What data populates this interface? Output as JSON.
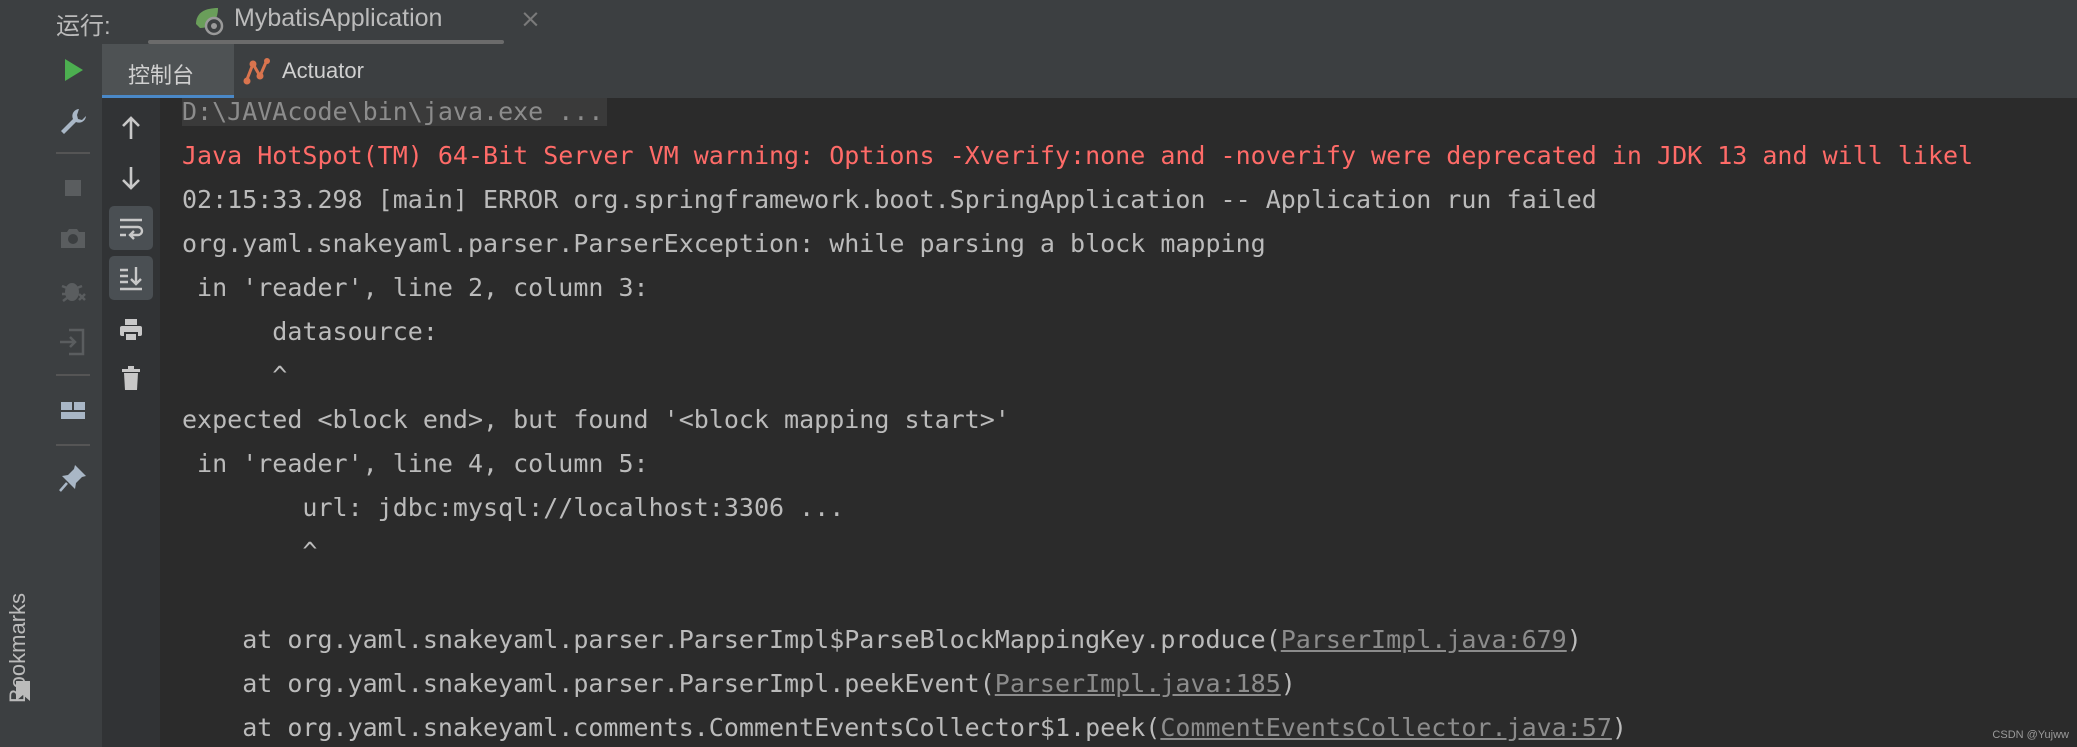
{
  "run_bar": {
    "label": "运行:",
    "config_name": "MybatisApplication",
    "close_glyph": "×"
  },
  "side_panel": {
    "bookmarks_label": "Bookmarks"
  },
  "tabs": [
    {
      "label": "控制台",
      "active": true
    },
    {
      "label": "Actuator",
      "active": false
    }
  ],
  "icons": {
    "left_toolbar": [
      "run-icon",
      "build-wrench-icon",
      "stop-icon",
      "camera-icon",
      "debug-bug-icon",
      "login-icon",
      "layout-icon",
      "pin-icon"
    ],
    "console_toolbar": [
      "scroll-up-icon",
      "scroll-down-icon",
      "soft-wrap-icon",
      "scroll-to-end-icon",
      "print-icon",
      "trash-icon"
    ]
  },
  "colors": {
    "background": "#2b2b2b",
    "error_text": "#ff6b68",
    "normal_text": "#bbbbbb",
    "run_green": "#4caf50"
  },
  "console": {
    "lines": [
      {
        "text": "D:\\JAVAcode\\bin\\java.exe ..."
      },
      {
        "text": "Java HotSpot(TM) 64-Bit Server VM warning: Options -Xverify:none and -noverify were deprecated in JDK 13 and will likel"
      },
      {
        "text": "02:15:33.298 [main] ERROR org.springframework.boot.SpringApplication -- Application run failed"
      },
      {
        "text": "org.yaml.snakeyaml.parser.ParserException: while parsing a block mapping"
      },
      {
        "text": " in 'reader', line 2, column 3:"
      },
      {
        "text": "      datasource:"
      },
      {
        "text": "      ^"
      },
      {
        "text": "expected <block end>, but found '<block mapping start>'"
      },
      {
        "text": " in 'reader', line 4, column 5:"
      },
      {
        "text": "        url: jdbc:mysql://localhost:3306 ..."
      },
      {
        "text": "        ^"
      },
      {
        "text": ""
      },
      {
        "text": "    at org.yaml.snakeyaml.parser.ParserImpl$ParseBlockMappingKey.produce(",
        "link": "ParserImpl.java:679",
        "suffix": ")"
      },
      {
        "text": "    at org.yaml.snakeyaml.parser.ParserImpl.peekEvent(",
        "link": "ParserImpl.java:185",
        "suffix": ")"
      },
      {
        "text": "    at org.yaml.snakeyaml.comments.CommentEventsCollector$1.peek(",
        "link": "CommentEventsCollector.java:57",
        "suffix": ")"
      }
    ]
  },
  "watermark": "CSDN @Yujww"
}
